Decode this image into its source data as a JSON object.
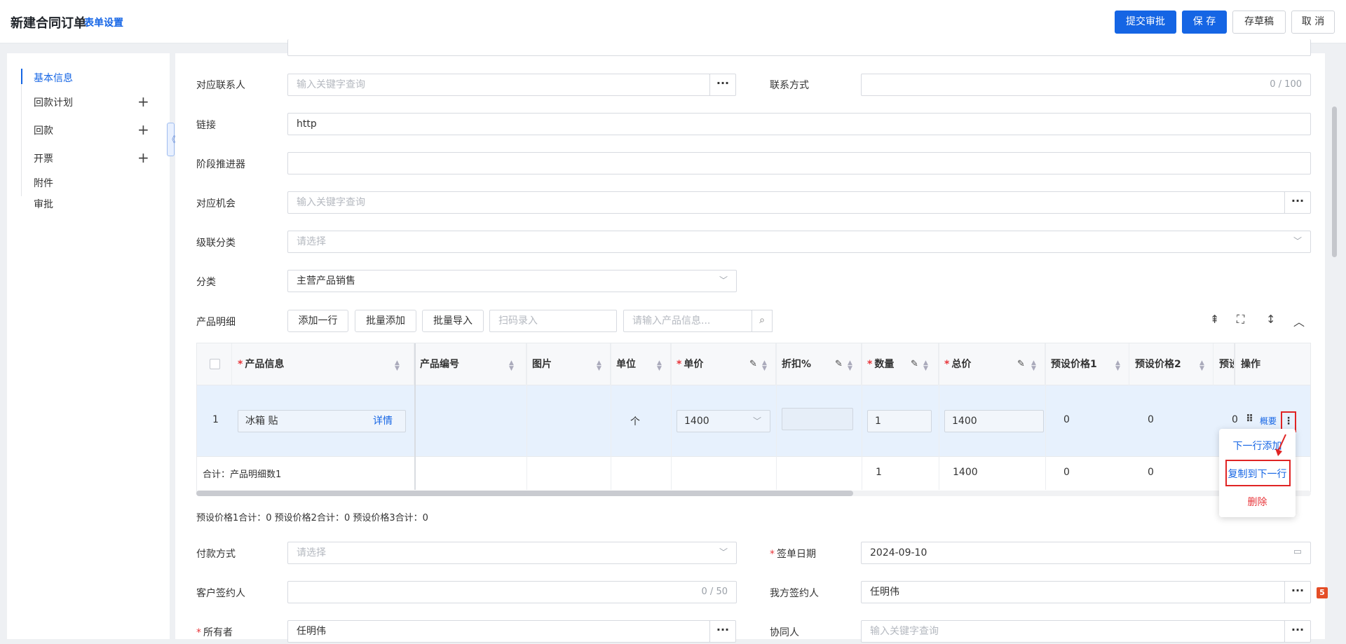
{
  "header": {
    "title": "新建合同订单",
    "form_settings": "表单设置",
    "buttons": {
      "submit": "提交审批",
      "save": "保 存",
      "draft": "存草稿",
      "cancel": "取 消"
    }
  },
  "sidebar": {
    "items": [
      {
        "label": "基本信息",
        "active": true
      },
      {
        "label": "回款计划",
        "plus": "+"
      },
      {
        "label": "回款",
        "plus": "+"
      },
      {
        "label": "开票",
        "plus": "+"
      },
      {
        "label": "附件"
      },
      {
        "label": "审批"
      }
    ],
    "collapse_icon": "《"
  },
  "form": {
    "contact": {
      "label": "对应联系人",
      "placeholder": "输入关键字查询",
      "btn": "···"
    },
    "phone": {
      "label": "联系方式",
      "counter": "0 / 100"
    },
    "link": {
      "label": "链接",
      "value": "http"
    },
    "stage": {
      "label": "阶段推进器"
    },
    "opportunity": {
      "label": "对应机会",
      "placeholder": "输入关键字查询",
      "btn": "···"
    },
    "cascade": {
      "label": "级联分类",
      "placeholder": "请选择"
    },
    "category": {
      "label": "分类",
      "value": "主营产品销售"
    },
    "products": {
      "label": "产品明细",
      "add_row": "添加一行",
      "batch_add": "批量添加",
      "batch_import": "批量导入",
      "scan_placeholder": "扫码录入",
      "search_placeholder": "请输入产品信息..."
    }
  },
  "table": {
    "headers": {
      "product_info": "产品信息",
      "product_no": "产品编号",
      "image": "图片",
      "unit": "单位",
      "price": "单价",
      "discount": "折扣%",
      "qty": "数量",
      "total": "总价",
      "preset1": "预设价格1",
      "preset2": "预设价格2",
      "preset3": "预设",
      "ops": "操作"
    },
    "row": {
      "index": "1",
      "product": "冰箱 贴",
      "detail": "详情",
      "unit": "个",
      "price": "1400",
      "qty": "1",
      "total": "1400",
      "preset1": "0",
      "preset2": "0",
      "preset3": "0",
      "summary_link": "概要"
    },
    "footer": {
      "label": "合计：产品明细数1",
      "qty": "1",
      "total": "1400",
      "preset1": "0",
      "preset2": "0"
    }
  },
  "popup": {
    "add_next": "下一行添加",
    "copy_next": "复制到下一行",
    "delete": "删除"
  },
  "summary": {
    "text": "预设价格1合计：0  预设价格2合计：0  预设价格3合计：0"
  },
  "form2": {
    "payment": {
      "label": "付款方式",
      "placeholder": "请选择"
    },
    "sign_date": {
      "label": "签单日期",
      "value": "2024-09-10"
    },
    "cust_signer": {
      "label": "客户签约人",
      "counter": "0 / 50"
    },
    "our_signer": {
      "label": "我方签约人",
      "value": "任明伟"
    },
    "owner": {
      "label": "所有者",
      "value": "任明伟"
    },
    "collaborator": {
      "label": "协同人",
      "placeholder": "输入关键字查询"
    }
  },
  "colors": {
    "primary": "#1565e4",
    "danger": "#e8353a",
    "row_highlight": "#e7f1fd"
  }
}
